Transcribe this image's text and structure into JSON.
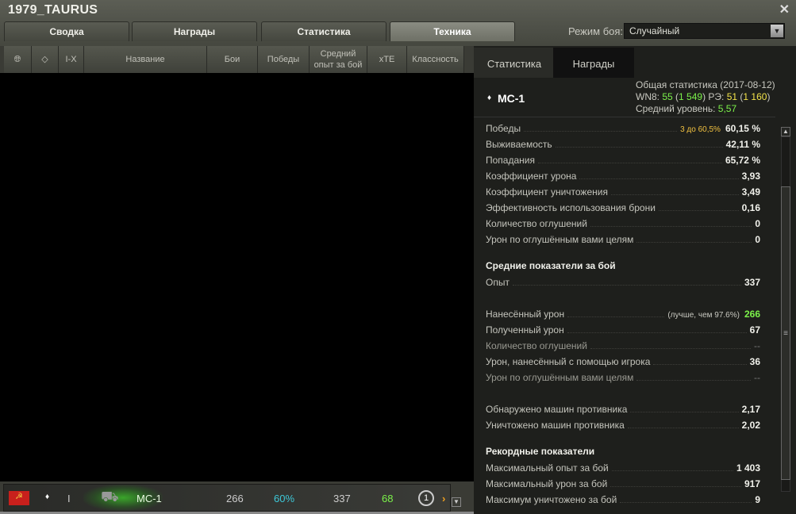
{
  "window": {
    "title": "1979_TAURUS"
  },
  "tabs": [
    "Сводка",
    "Награды",
    "Статистика",
    "Техника"
  ],
  "mode": {
    "label": "Режим боя:",
    "value": "Случайный"
  },
  "columns": {
    "tier": "I-X",
    "name": "Название",
    "battles": "Бои",
    "wins": "Победы",
    "avg_xp_1": "Средний",
    "avg_xp_2": "опыт за бой",
    "xte": "xTE",
    "class": "Классность"
  },
  "vehicle_row": {
    "tier": "I",
    "name": "МС-1",
    "battles": "266",
    "wins": "60%",
    "avg_xp": "337",
    "xte": "68",
    "mastery": "1"
  },
  "right_tabs": [
    "Статистика",
    "Награды"
  ],
  "vehicle": {
    "name": "МС-1",
    "summary_title": "Общая статистика (2017-08-12)",
    "wn8_label": "WN8: ",
    "wn8": "55",
    "wn8_paren": "1 549",
    "re_label": " РЭ: ",
    "re": "51",
    "re_paren": "1 160",
    "avg_level_label": "Средний уровень: ",
    "avg_level": "5,57"
  },
  "colors": {
    "green": "#7cf24a",
    "yellow": "#f2e24a",
    "teal": "#3ec8d8",
    "gold": "#f0c040"
  },
  "stats": [
    {
      "label": "Победы",
      "note": "3 до 60,5%",
      "value": "60,15 %"
    },
    {
      "label": "Выживаемость",
      "value": "42,11 %"
    },
    {
      "label": "Попадания",
      "value": "65,72 %"
    },
    {
      "label": "Коэффициент урона",
      "value": "3,93"
    },
    {
      "label": "Коэффициент уничтожения",
      "value": "3,49"
    },
    {
      "label": "Эффективность использования брони",
      "value": "0,16"
    },
    {
      "label": "Количество оглушений",
      "value": "0"
    },
    {
      "label": "Урон по оглушённым вами целям",
      "value": "0"
    }
  ],
  "avg_section": "Средние показатели за бой",
  "avg_stats": [
    {
      "label": "Опыт",
      "value": "337"
    },
    {
      "label": "Нанесённый урон",
      "note": "(лучше, чем 97.6%)",
      "value": "266"
    },
    {
      "label": "Полученный урон",
      "value": "67"
    },
    {
      "label": "Количество оглушений",
      "value": "--"
    },
    {
      "label": "Урон, нанесённый с помощью игрока",
      "value": "36"
    },
    {
      "label": "Урон по оглушённым вами целям",
      "value": "--"
    },
    {
      "label": "Обнаружено машин противника",
      "value": "2,17"
    },
    {
      "label": "Уничтожено машин противника",
      "value": "2,02"
    }
  ],
  "record_section": "Рекордные показатели",
  "records": [
    {
      "label": "Максимальный опыт за бой",
      "value": "1 403"
    },
    {
      "label": "Максимальный урон за бой",
      "value": "917"
    },
    {
      "label": "Максимум уничтожено за бой",
      "value": "9"
    }
  ]
}
